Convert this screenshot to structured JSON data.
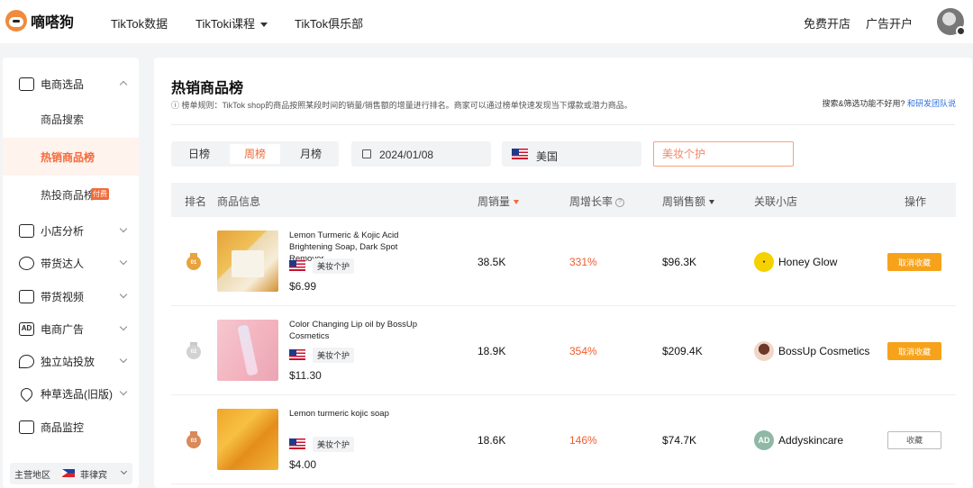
{
  "brand": {
    "name": "嘀嗒狗"
  },
  "nav": {
    "items": [
      "TikTok数据",
      "TikToki课程",
      "TikTok俱乐部"
    ],
    "right": [
      "免费开店",
      "广告开户"
    ]
  },
  "sidebar": {
    "menus": [
      {
        "label": "电商选品",
        "icon": "shopping-bag-icon",
        "expanded": true
      },
      {
        "label": "小店分析",
        "icon": "store-icon"
      },
      {
        "label": "带货达人",
        "icon": "user-icon"
      },
      {
        "label": "带货视频",
        "icon": "video-icon"
      },
      {
        "label": "电商广告",
        "icon": "ad-icon"
      },
      {
        "label": "独立站投放",
        "icon": "location-icon"
      },
      {
        "label": "种草选品(旧版)",
        "icon": "heart-icon"
      },
      {
        "label": "商品监控",
        "icon": "monitor-chart-icon"
      }
    ],
    "sub_items": [
      {
        "label": "商品搜索",
        "active": false
      },
      {
        "label": "热销商品榜",
        "active": true
      },
      {
        "label": "热投商品榜",
        "active": false,
        "tag": "付费"
      }
    ],
    "region": {
      "label": "主营地区",
      "value": "菲律宾"
    }
  },
  "page": {
    "title": "热销商品榜",
    "rule_note": "榜单规则：TikTok shop的商品按照某段时间的销量/销售额的增量进行排名。商家可以通过榜单快速发现当下爆款或潜力商品。",
    "help_text": "搜索&筛选功能不好用?",
    "help_link": "和研发团队说"
  },
  "filters": {
    "tabs": [
      "日榜",
      "周榜",
      "月榜"
    ],
    "active_tab": "周榜",
    "date": "2024/01/08",
    "country": "美国",
    "category_placeholder": "美妆个护"
  },
  "table": {
    "headers": {
      "rank": "排名",
      "product": "商品信息",
      "sales": "周销量",
      "growth": "周增长率",
      "amount": "周销售额",
      "shop": "关联小店",
      "action": "操作"
    },
    "rows": [
      {
        "rank": "01",
        "medal_color": "#e8a33d",
        "name": "Lemon Turmeric & Kojic Acid Brightening Soap, Dark Spot Remover,...",
        "category": "美妆个护",
        "price": "$6.99",
        "sales": "38.5K",
        "growth": "331%",
        "amount": "$96.3K",
        "shop": "Honey Glow",
        "action": "取消收藏",
        "favorited": true
      },
      {
        "rank": "02",
        "medal_color": "#c9c9c9",
        "name": "Color Changing Lip oil by BossUp Cosmetics",
        "category": "美妆个护",
        "price": "$11.30",
        "sales": "18.9K",
        "growth": "354%",
        "amount": "$209.4K",
        "shop": "BossUp Cosmetics",
        "action": "取消收藏",
        "favorited": true
      },
      {
        "rank": "03",
        "medal_color": "#d9895a",
        "name": "Lemon turmeric kojic soap",
        "category": "美妆个护",
        "price": "$4.00",
        "sales": "18.6K",
        "growth": "146%",
        "amount": "$74.7K",
        "shop": "Addyskincare",
        "action": "收藏",
        "favorited": false
      }
    ]
  }
}
